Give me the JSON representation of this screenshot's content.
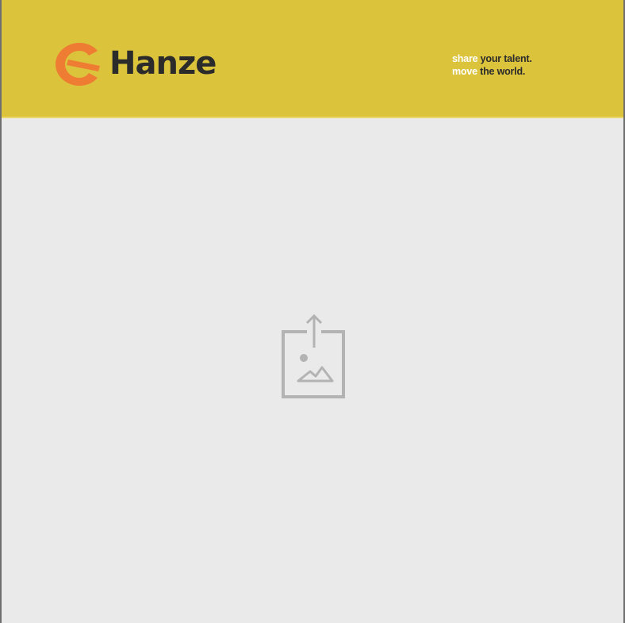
{
  "banner": {
    "background_color": "#dbc33c",
    "logo": {
      "icon": "hanze-logo-icon",
      "icon_color": "#ee7c32",
      "text": "Hanze"
    },
    "tagline": {
      "line1_prefix": "share",
      "line1_suffix": "your talent.",
      "line2_prefix": "move",
      "line2_suffix": "the world."
    }
  },
  "content": {
    "background_color": "#eaeaea",
    "placeholder_icon": "image-upload-icon"
  }
}
